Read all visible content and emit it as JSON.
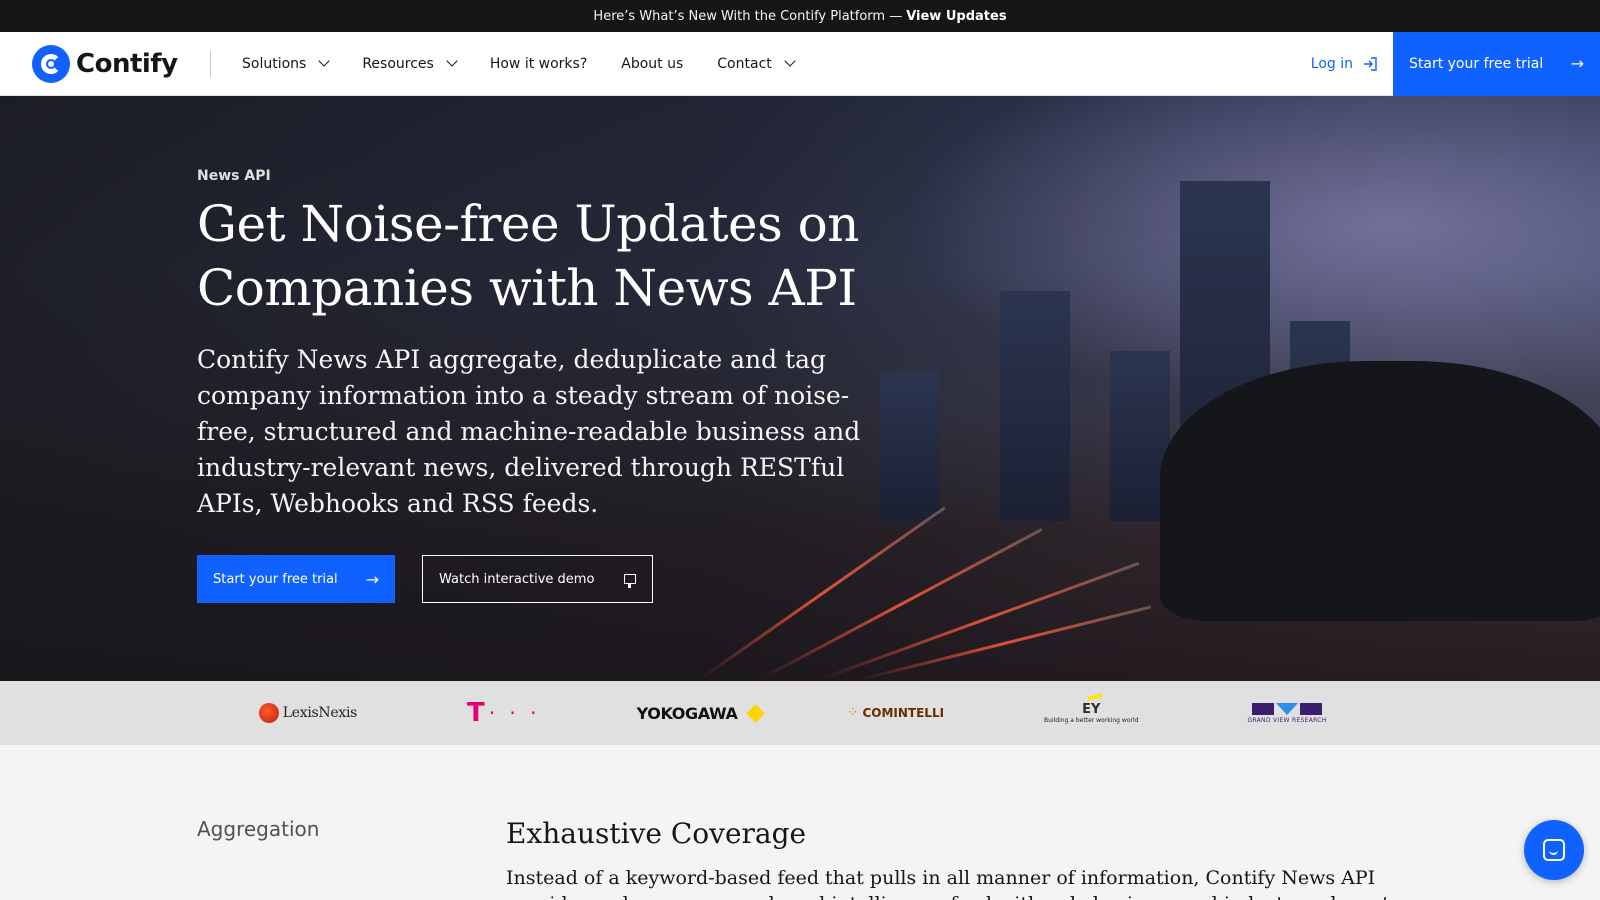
{
  "announcement": {
    "text": "Here’s What’s New With the Contify Platform —",
    "link": "View Updates"
  },
  "nav": {
    "brand": "Contify",
    "items": [
      {
        "label": "Solutions",
        "dropdown": true
      },
      {
        "label": "Resources",
        "dropdown": true
      },
      {
        "label": "How it works?",
        "dropdown": false
      },
      {
        "label": "About us",
        "dropdown": false
      },
      {
        "label": "Contact",
        "dropdown": true
      }
    ],
    "login": "Log in",
    "trial": "Start your free trial"
  },
  "hero": {
    "eyebrow": "News API",
    "title": "Get Noise-free Updates on Companies with News API",
    "description": "Contify News API aggregate, deduplicate and tag company information into a steady stream of noise-free, structured and machine-readable business and industry-relevant news, delivered through RESTful APIs, Webhooks and RSS feeds.",
    "primary_cta": "Start your free trial",
    "secondary_cta": "Watch interactive demo"
  },
  "clients": {
    "lexisnexis": "LexisNexis",
    "tmobile": "T",
    "tmobile_dots": "· · ·",
    "yokogawa": "YOKOGAWA",
    "comintelli": "COMINTELLI",
    "ey": "EY",
    "ey_tagline": "Building a better working world",
    "gvr": "GRAND VIEW RESEARCH"
  },
  "section": {
    "label": "Aggregation",
    "title": "Exhaustive Coverage",
    "body": "Instead of a keyword-based feed that pulls in all manner of information, Contify News API provides a clean, company-based intelligence feed with only business and industry-relevant information."
  },
  "colors": {
    "primary": "#0f62fe",
    "announce_bg": "#161616",
    "logo_strip_bg": "#e0e0e0"
  }
}
